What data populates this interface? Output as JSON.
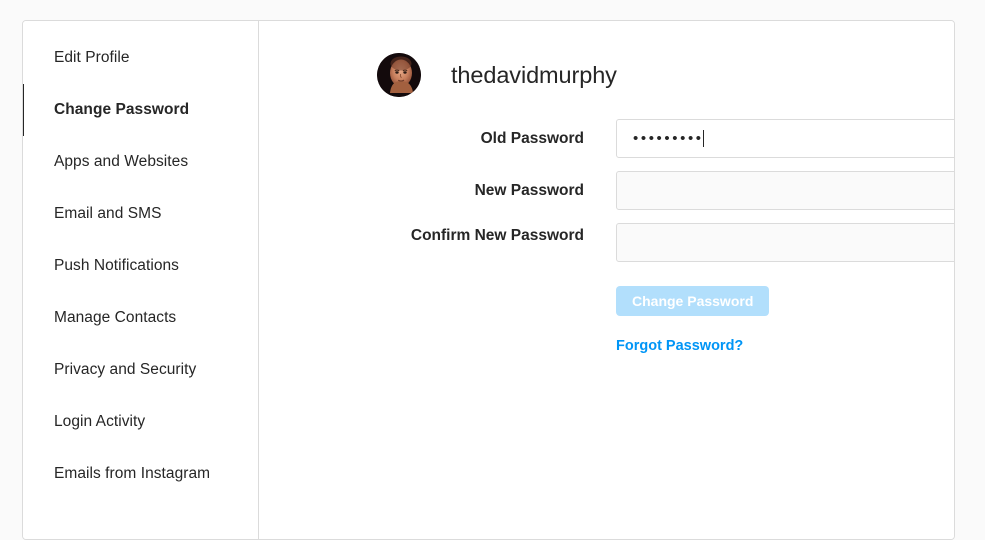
{
  "sidebar": {
    "items": [
      {
        "label": "Edit Profile",
        "active": false
      },
      {
        "label": "Change Password",
        "active": true
      },
      {
        "label": "Apps and Websites",
        "active": false
      },
      {
        "label": "Email and SMS",
        "active": false
      },
      {
        "label": "Push Notifications",
        "active": false
      },
      {
        "label": "Manage Contacts",
        "active": false
      },
      {
        "label": "Privacy and Security",
        "active": false
      },
      {
        "label": "Login Activity",
        "active": false
      },
      {
        "label": "Emails from Instagram",
        "active": false
      }
    ]
  },
  "profile": {
    "username": "thedavidmurphy",
    "avatar_icon": "user-avatar-photo"
  },
  "form": {
    "old_password": {
      "label": "Old Password",
      "value": "•••••••••",
      "placeholder": "",
      "focused": true
    },
    "new_password": {
      "label": "New Password",
      "value": "",
      "placeholder": "",
      "focused": false
    },
    "confirm_new_password": {
      "label": "Confirm New Password",
      "value": "",
      "placeholder": "",
      "focused": false
    }
  },
  "actions": {
    "submit_label": "Change Password",
    "forgot_label": "Forgot Password?"
  },
  "colors": {
    "accent_link": "#0095f6",
    "button_disabled": "#b2dffc",
    "border": "#dbdbdb",
    "page_background": "#fafafa",
    "text": "#262626"
  }
}
